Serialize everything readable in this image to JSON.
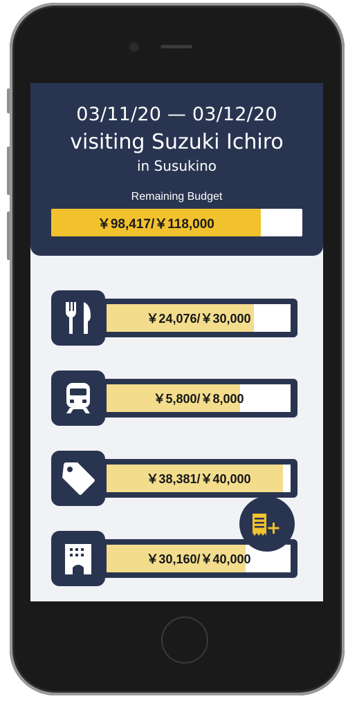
{
  "trip": {
    "dates": "03/11/20 — 03/12/20",
    "title": "visiting Suzuki Ichiro",
    "location": "in Susukino"
  },
  "budget": {
    "label": "Remaining Budget",
    "text": "￥98,417/￥118,000",
    "fraction": 0.834,
    "fill_color": "#f2c12e"
  },
  "categories": [
    {
      "icon": "fork-knife-icon",
      "text": "￥24,076/￥30,000",
      "fraction": 0.8
    },
    {
      "icon": "train-icon",
      "text": "￥5,800/￥8,000",
      "fraction": 0.725
    },
    {
      "icon": "price-tag-icon",
      "text": "￥38,381/￥40,000",
      "fraction": 0.96
    },
    {
      "icon": "hotel-building-icon",
      "text": "￥30,160/￥40,000",
      "fraction": 0.754
    }
  ],
  "fab": {
    "icon": "add-receipt-icon"
  },
  "colors": {
    "navy": "#293550",
    "gold": "#f2c12e",
    "pale_gold": "#f3dd8d",
    "background": "#f1f2f5"
  }
}
